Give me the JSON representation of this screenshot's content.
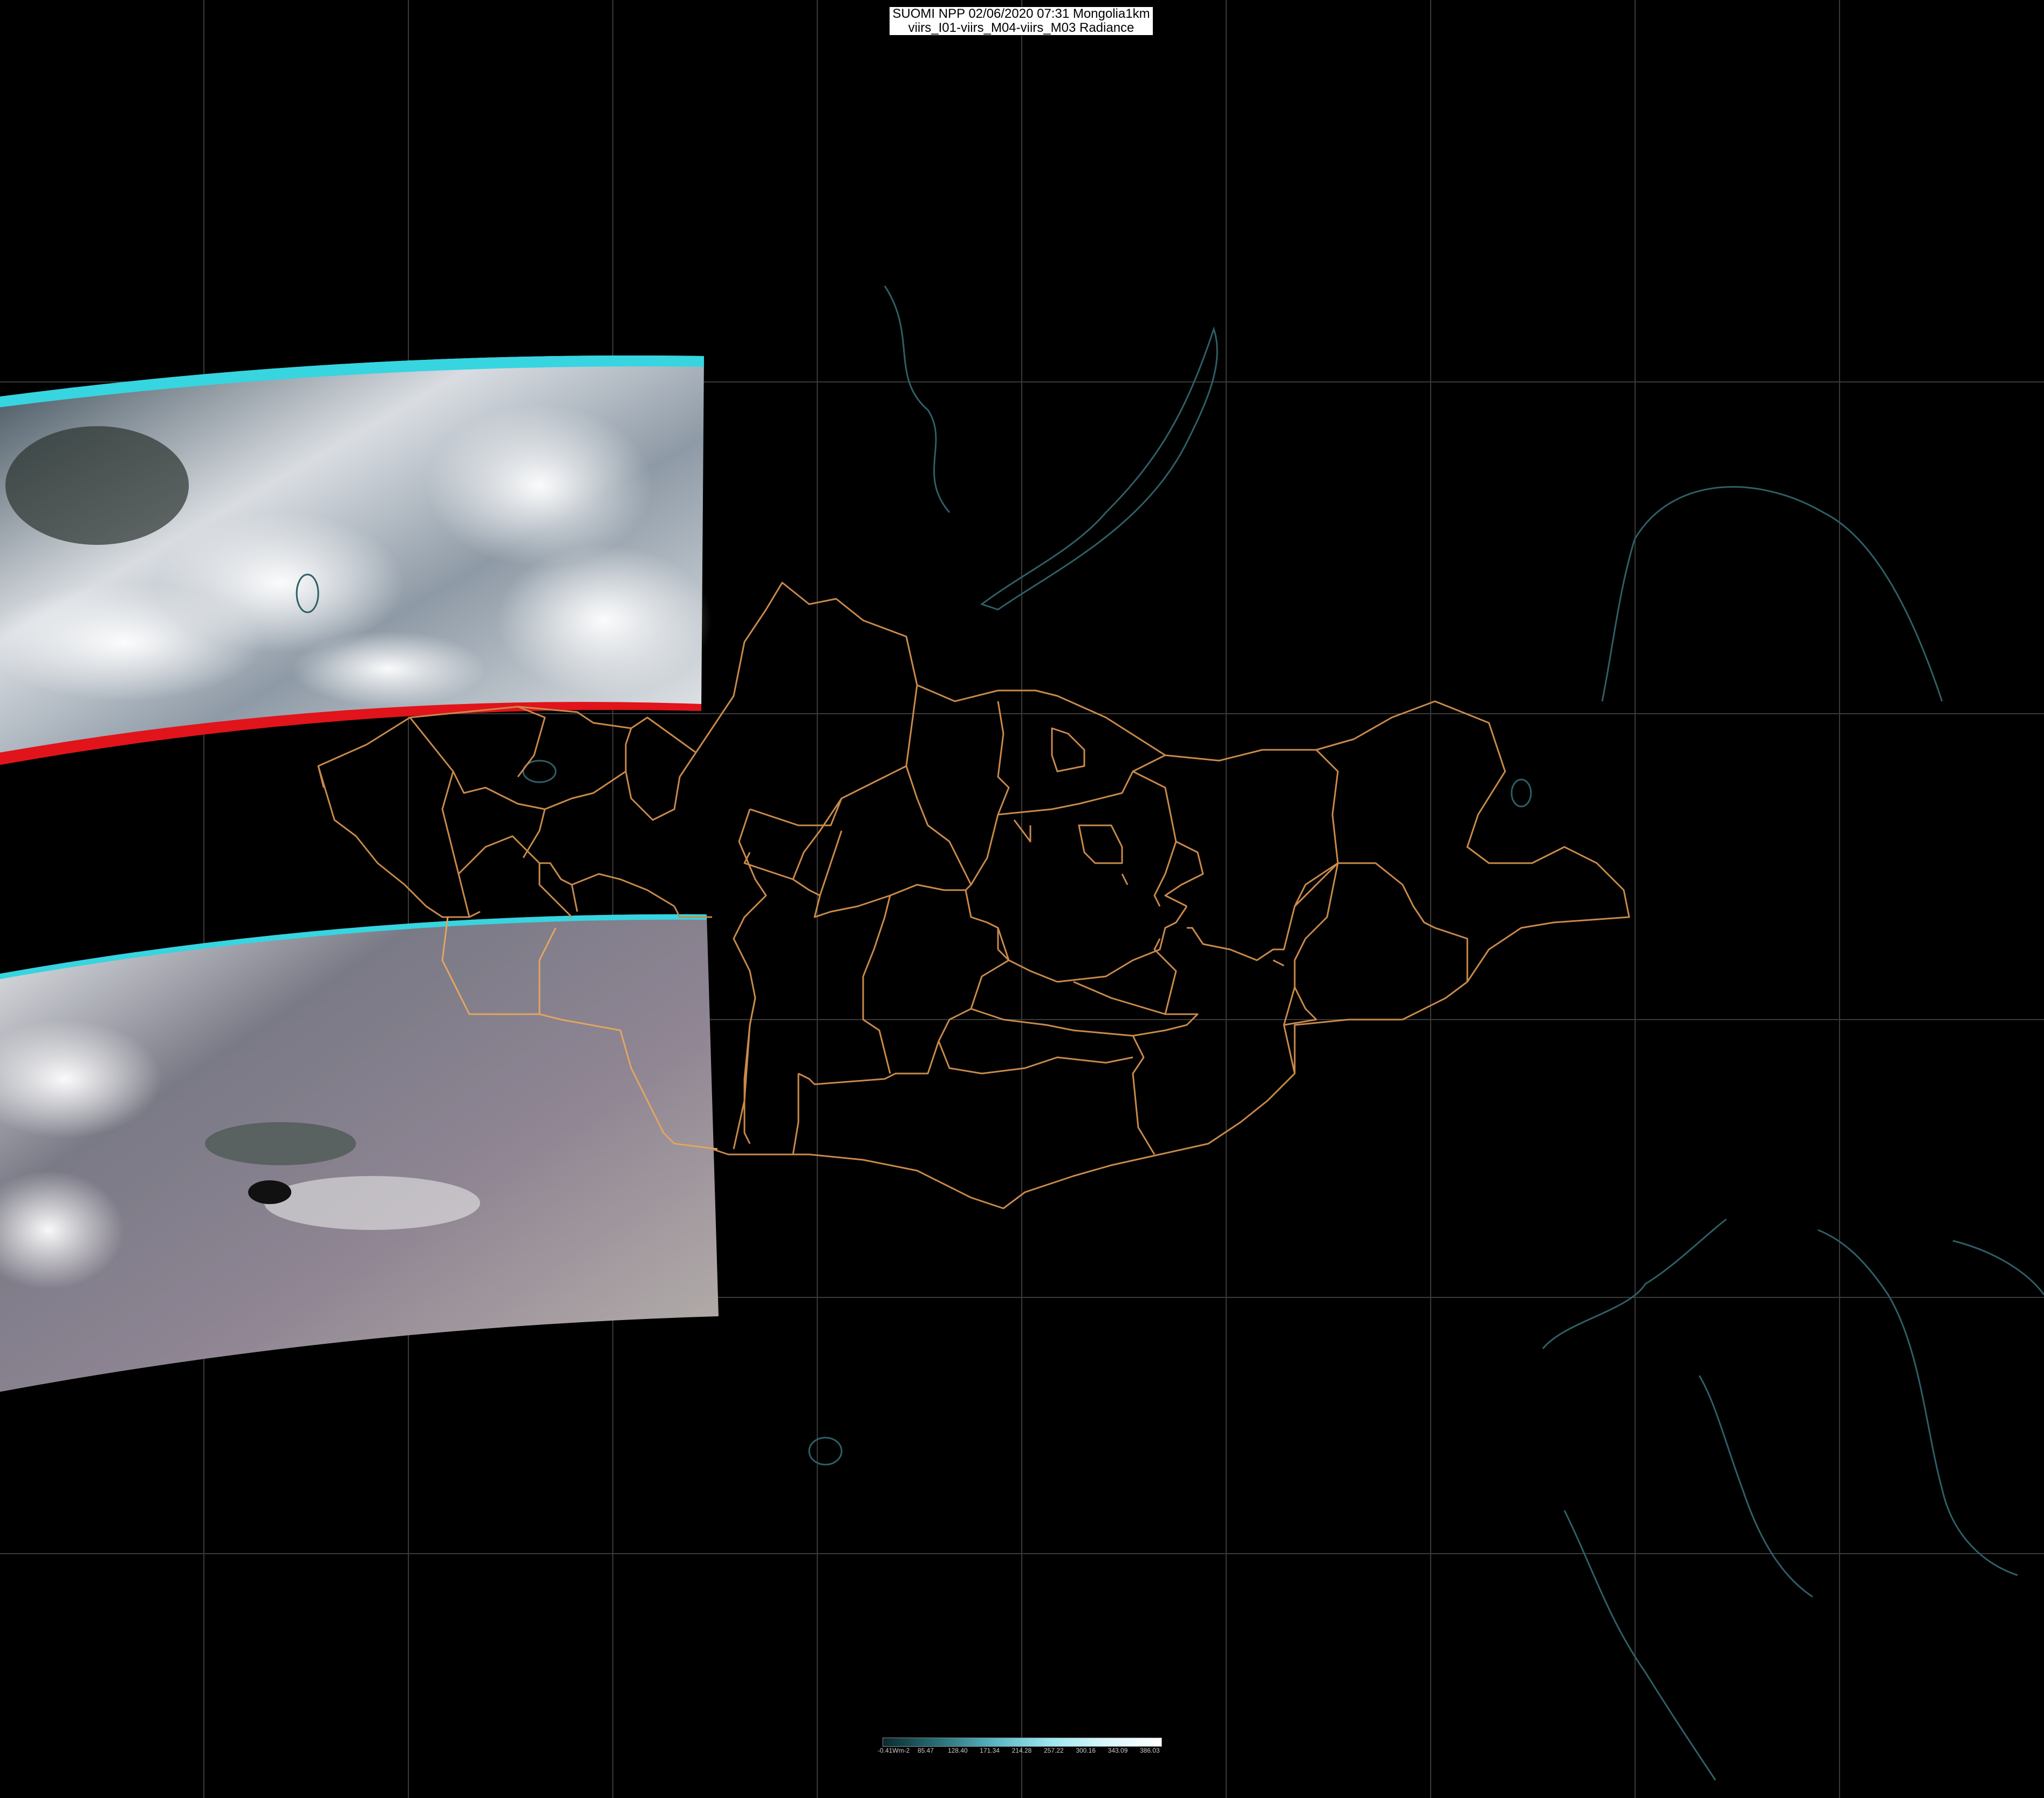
{
  "header": {
    "line1": "SUOMI NPP 02/06/2020 07:31 Mongolia1km",
    "line2": "viirs_I01-viirs_M04-viirs_M03 Radiance"
  },
  "colorbar": {
    "ticks": [
      "-0.41Wm-2",
      "85.47",
      "128.40",
      "171.34",
      "214.28",
      "257.22",
      "300.16",
      "343.09",
      "386.03"
    ],
    "colors": [
      "#0a2a2e",
      "#2a6f78",
      "#58b6c2",
      "#9ee6ef",
      "#d7f7fb",
      "#ffffff"
    ]
  },
  "map": {
    "graticule_color": "#3a3a3a",
    "border_color": "#c98a4a",
    "coast_color": "#2e5f66",
    "swaths": [
      {
        "name": "northern-swath",
        "cloud": true
      },
      {
        "name": "southern-swath",
        "cloud": false
      }
    ]
  }
}
